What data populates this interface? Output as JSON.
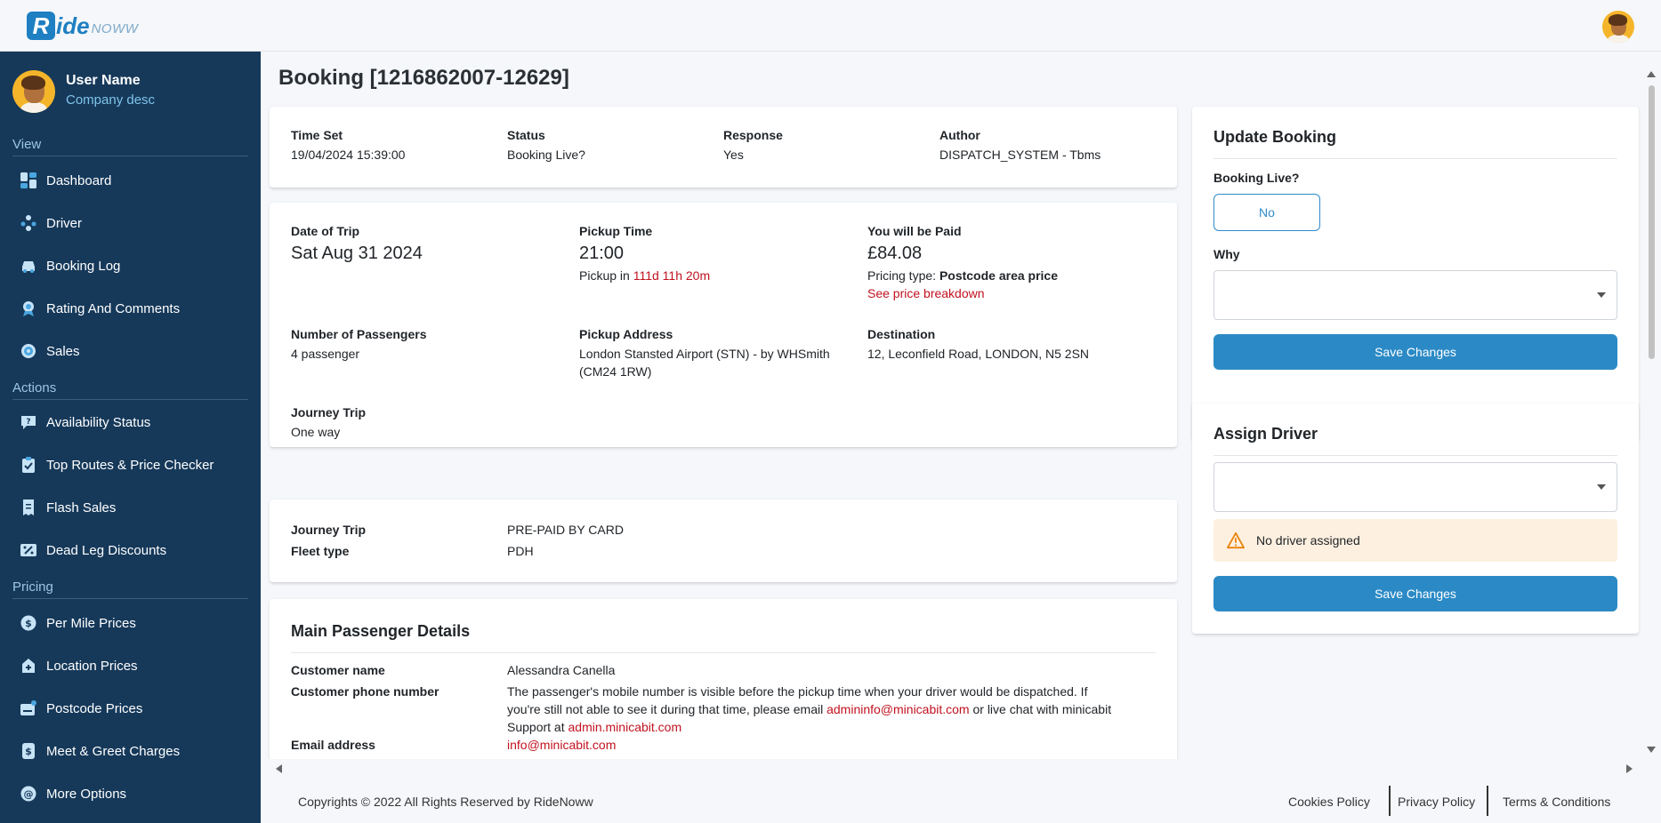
{
  "brand": {
    "logo_letter": "R",
    "logo_text": "ide",
    "logo_suffix": "NOWW"
  },
  "user": {
    "name": "User Name",
    "company": "Company desc"
  },
  "sidebar": {
    "sections": {
      "view": "View",
      "actions": "Actions",
      "pricing": "Pricing"
    },
    "view_items": [
      {
        "label": "Dashboard",
        "icon": "dashboard-icon"
      },
      {
        "label": "Driver",
        "icon": "driver-icon"
      },
      {
        "label": "Booking Log",
        "icon": "car-icon"
      },
      {
        "label": "Rating And Comments",
        "icon": "award-icon"
      },
      {
        "label": "Sales",
        "icon": "sales-icon"
      }
    ],
    "action_items": [
      {
        "label": "Availability Status",
        "icon": "question-icon"
      },
      {
        "label": "Top Routes & Price Checker",
        "icon": "clipboard-check-icon"
      },
      {
        "label": "Flash Sales",
        "icon": "receipt-icon"
      },
      {
        "label": "Dead Leg Discounts",
        "icon": "discount-icon"
      }
    ],
    "pricing_items": [
      {
        "label": "Per Mile Prices",
        "icon": "dollar-icon"
      },
      {
        "label": "Location Prices",
        "icon": "location-plus-icon"
      },
      {
        "label": "Postcode Prices",
        "icon": "postcode-icon"
      },
      {
        "label": "Meet & Greet Charges",
        "icon": "dollar-tag-icon"
      },
      {
        "label": "More Options",
        "icon": "more-options-icon"
      }
    ]
  },
  "booking": {
    "title": "Booking [1216862007-12629]",
    "status_card": {
      "time_set_label": "Time Set",
      "time_set_value": "19/04/2024 15:39:00",
      "status_label": "Status",
      "status_value": "Booking Live?",
      "response_label": "Response",
      "response_value": "Yes",
      "author_label": "Author",
      "author_value": "DISPATCH_SYSTEM - Tbms"
    },
    "trip_card": {
      "date_label": "Date of Trip",
      "date_value": "Sat Aug 31 2024",
      "pickup_time_label": "Pickup Time",
      "pickup_time_value": "21:00",
      "pickup_in_prefix": "Pickup in",
      "pickup_in_value": "111d 11h 20m",
      "paid_label": "You will be Paid",
      "paid_value": "£84.08",
      "pricing_type_prefix": "Pricing type:",
      "pricing_type_value": "Postcode area price",
      "price_breakdown_link": "See price breakdown",
      "passengers_label": "Number of Passengers",
      "passengers_value": "4 passenger",
      "pickup_address_label": "Pickup Address",
      "pickup_address_line1": "London Stansted Airport (STN) - by WHSmith",
      "pickup_address_line2": "(CM24 1RW)",
      "destination_label": "Destination",
      "destination_value": "12, Leconfield Road, LONDON, N5 2SN",
      "journey_label": "Journey Trip",
      "journey_value": "One way"
    },
    "payment_card": {
      "journey_label": "Journey Trip",
      "journey_value": "PRE-PAID BY CARD",
      "fleet_label": "Fleet type",
      "fleet_value": "PDH"
    },
    "passenger_card": {
      "title": "Main Passenger Details",
      "customer_name_label": "Customer name",
      "customer_name_value": "Alessandra Canella",
      "phone_label": "Customer phone number",
      "phone_line1": "The passenger's mobile number is visible before the pickup time when your driver would be dispatched. If",
      "phone_line2_pre": "you're still not able to see it during that time, please email",
      "phone_email_link": "admininfo@minicabit.com",
      "phone_line2_post": "or live chat with minicabit",
      "phone_line3_pre": "Support at",
      "phone_support_link": "admin.minicabit.com",
      "email_label": "Email address",
      "email_value": "info@minicabit.com"
    }
  },
  "update_booking": {
    "title": "Update Booking",
    "live_label": "Booking Live?",
    "live_button": "No",
    "why_label": "Why",
    "why_value": "",
    "save_label": "Save Changes"
  },
  "assign_driver": {
    "title": "Assign Driver",
    "driver_value": "",
    "alert_text": "No driver assigned",
    "save_label": "Save Changes"
  },
  "footer": {
    "copyright": "Copyrights © 2022 All Rights Reserved by RideNoww",
    "cookies": "Cookies Policy",
    "privacy": "Privacy Policy",
    "terms": "Terms & Conditions"
  },
  "colors": {
    "sidebar_bg": "#16395a",
    "accent": "#2b8ac6",
    "link_red": "#c1121f",
    "alert_bg": "#fef0e0",
    "avatar_bg": "#f5b52a"
  }
}
